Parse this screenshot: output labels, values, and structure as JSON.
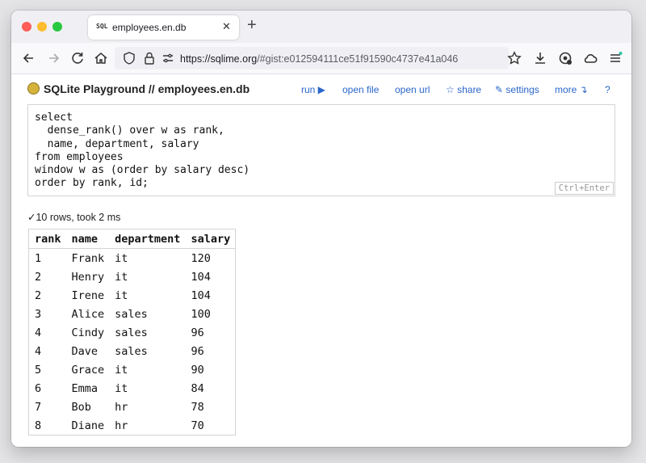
{
  "browser": {
    "tab": {
      "favicon": "SQL",
      "title": "employees.en.db"
    },
    "new_tab_symbol": "+",
    "url": {
      "host": "https://sqlime.org",
      "path": "/#gist:e012594111ce51f91590c4737e41a046"
    },
    "icons": [
      "back-icon",
      "forward-icon",
      "reload-icon",
      "home-icon",
      "shield-icon",
      "lock-icon",
      "permissions-icon",
      "bookmark-star-icon",
      "download-icon",
      "extension-icon",
      "account-icon",
      "menu-icon"
    ]
  },
  "app": {
    "title": "SQLite Playground // employees.en.db",
    "toolbar": {
      "run": "run ▶",
      "open_file": "open file",
      "open_url": "open url",
      "share": "☆ share",
      "settings": "✎ settings",
      "more": "more ↴",
      "help": "?"
    }
  },
  "editor": {
    "lines": [
      "select",
      "  dense_rank() over w as rank,",
      "  name, department, salary",
      "from employees",
      "window w as (order by salary desc)",
      "order by rank, id;"
    ],
    "hint": "Ctrl+Enter"
  },
  "status": "✓10 rows, took 2 ms",
  "results": {
    "columns": [
      "rank",
      "name",
      "department",
      "salary"
    ],
    "rows": [
      [
        "1",
        "Frank",
        "it",
        "120"
      ],
      [
        "2",
        "Henry",
        "it",
        "104"
      ],
      [
        "2",
        "Irene",
        "it",
        "104"
      ],
      [
        "3",
        "Alice",
        "sales",
        "100"
      ],
      [
        "4",
        "Cindy",
        "sales",
        "96"
      ],
      [
        "4",
        "Dave",
        "sales",
        "96"
      ],
      [
        "5",
        "Grace",
        "it",
        "90"
      ],
      [
        "6",
        "Emma",
        "it",
        "84"
      ],
      [
        "7",
        "Bob",
        "hr",
        "78"
      ],
      [
        "8",
        "Diane",
        "hr",
        "70"
      ]
    ]
  },
  "colors": {
    "link": "#2a66c9",
    "logo": "#d5b23a"
  }
}
